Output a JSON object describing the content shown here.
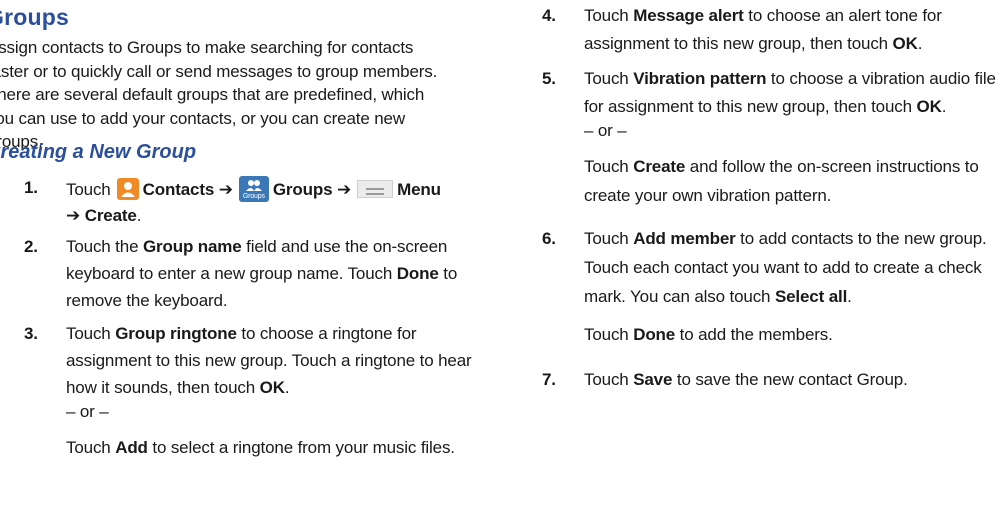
{
  "title": "Groups",
  "intro": [
    "Assign contacts to Groups to make searching for contacts",
    "faster or to quickly call or send messages to group members.",
    "There are several default groups that are predefined, which",
    "you can use to add your contacts, or you can create new",
    "groups."
  ],
  "subhead": "Creating a New Group",
  "steps": {
    "s1": {
      "num": "1.",
      "t_touch": "Touch",
      "b_contacts": "Contacts",
      "arrow1": "➔",
      "b_groups": "Groups",
      "groups_icon_caption": "Groups",
      "arrow2": "➔",
      "b_menu": "Menu",
      "arrow3": "➔",
      "b_create": "Create",
      "t_end": "."
    },
    "s2": {
      "num": "2.",
      "t1": "Touch the ",
      "b1": "Group name",
      "t2": " field and use the on-screen",
      "line2": "keyboard to enter a new group name. Touch ",
      "b2": "Done",
      "t3": " to",
      "line3": "remove the keyboard."
    },
    "s3": {
      "num": "3.",
      "t1": "Touch ",
      "b1": "Group ringtone",
      "t2": " to choose a ringtone for",
      "line2": "assignment to this new group. Touch a ringtone to hear",
      "line3a": "how it sounds, then touch ",
      "b2": "OK",
      "t3": ".",
      "or": "– or –",
      "t4": "Touch ",
      "b3": "Add",
      "t5": " to select a ringtone from your music files."
    },
    "s4": {
      "num": "4.",
      "t1": "Touch ",
      "b1": "Message alert",
      "t2": " to choose an alert tone for",
      "line2": "assignment to this new group, then touch ",
      "b2": "OK",
      "t3": "."
    },
    "s5": {
      "num": "5.",
      "t1": "Touch ",
      "b1": "Vibration pattern",
      "t2": " to choose a vibration audio file",
      "line2": "for assignment to this new group, then touch ",
      "b2": "OK",
      "t3": ".",
      "or": "– or –",
      "t4": "Touch ",
      "b3": "Create",
      "t5": " and follow the on-screen instructions to",
      "line5": "create your own vibration pattern."
    },
    "s6": {
      "num": "6.",
      "t1": "Touch ",
      "b1": "Add member",
      "t2": " to add contacts to the new group.",
      "line2": "Touch each contact you want to add to create a check",
      "line3a": "mark. You can also touch ",
      "b2": "Select all",
      "t3": ".",
      "t4": "Touch ",
      "b3": "Done",
      "t5": " to add the members."
    },
    "s7": {
      "num": "7.",
      "t1": "Touch ",
      "b1": "Save",
      "t2": " to save the new contact Group."
    }
  },
  "icons": {
    "contacts": "contacts-app-icon",
    "groups": "groups-tab-icon",
    "menu": "menu-key-icon",
    "contacts_color": "#f08a25",
    "groups_color": "#3a78b8",
    "heading_color": "#2b4f9e"
  }
}
